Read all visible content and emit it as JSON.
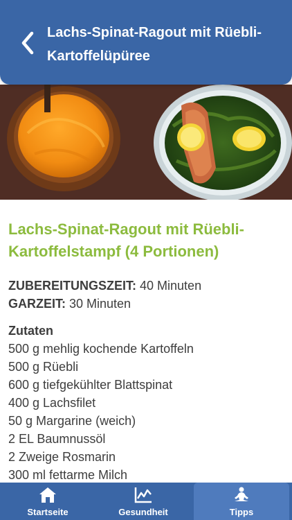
{
  "header": {
    "title": "Lachs-Spinat-Ragout mit Rüebli-Kartoffelüpüree",
    "back_icon": "chevron-left-icon"
  },
  "hero_image": {
    "description_icon": "salmon-spinach-dish-photo"
  },
  "recipe": {
    "title": "Lachs-Spinat-Ragout mit Rüebli-Kartoffelstampf (4 Portionen)",
    "prep_label": "ZUBEREITUNGSZEIT:",
    "prep_value": " 40 Minuten",
    "cook_label": "GARZEIT:",
    "cook_value": " 30 Minuten",
    "ingredients_heading": "Zutaten",
    "ingredients": [
      "500 g mehlig kochende Kartoffeln",
      "500 g Rüebli",
      "600 g tiefgekühlter Blattspinat",
      "400 g Lachsfilet",
      "50 g Margarine (weich)",
      "2 EL Baumnussöl",
      "2 Zweige Rosmarin",
      "300 ml fettarme Milch"
    ]
  },
  "tabs": [
    {
      "label": "Startseite",
      "icon": "home-icon",
      "active": false
    },
    {
      "label": "Gesundheit",
      "icon": "chart-icon",
      "active": false
    },
    {
      "label": "Tipps",
      "icon": "meditation-icon",
      "active": true
    }
  ],
  "colors": {
    "primary": "#3a66a6",
    "active_tab": "#4f7bbd",
    "title_green": "#8cbb3e",
    "text": "#3d3d3d"
  }
}
